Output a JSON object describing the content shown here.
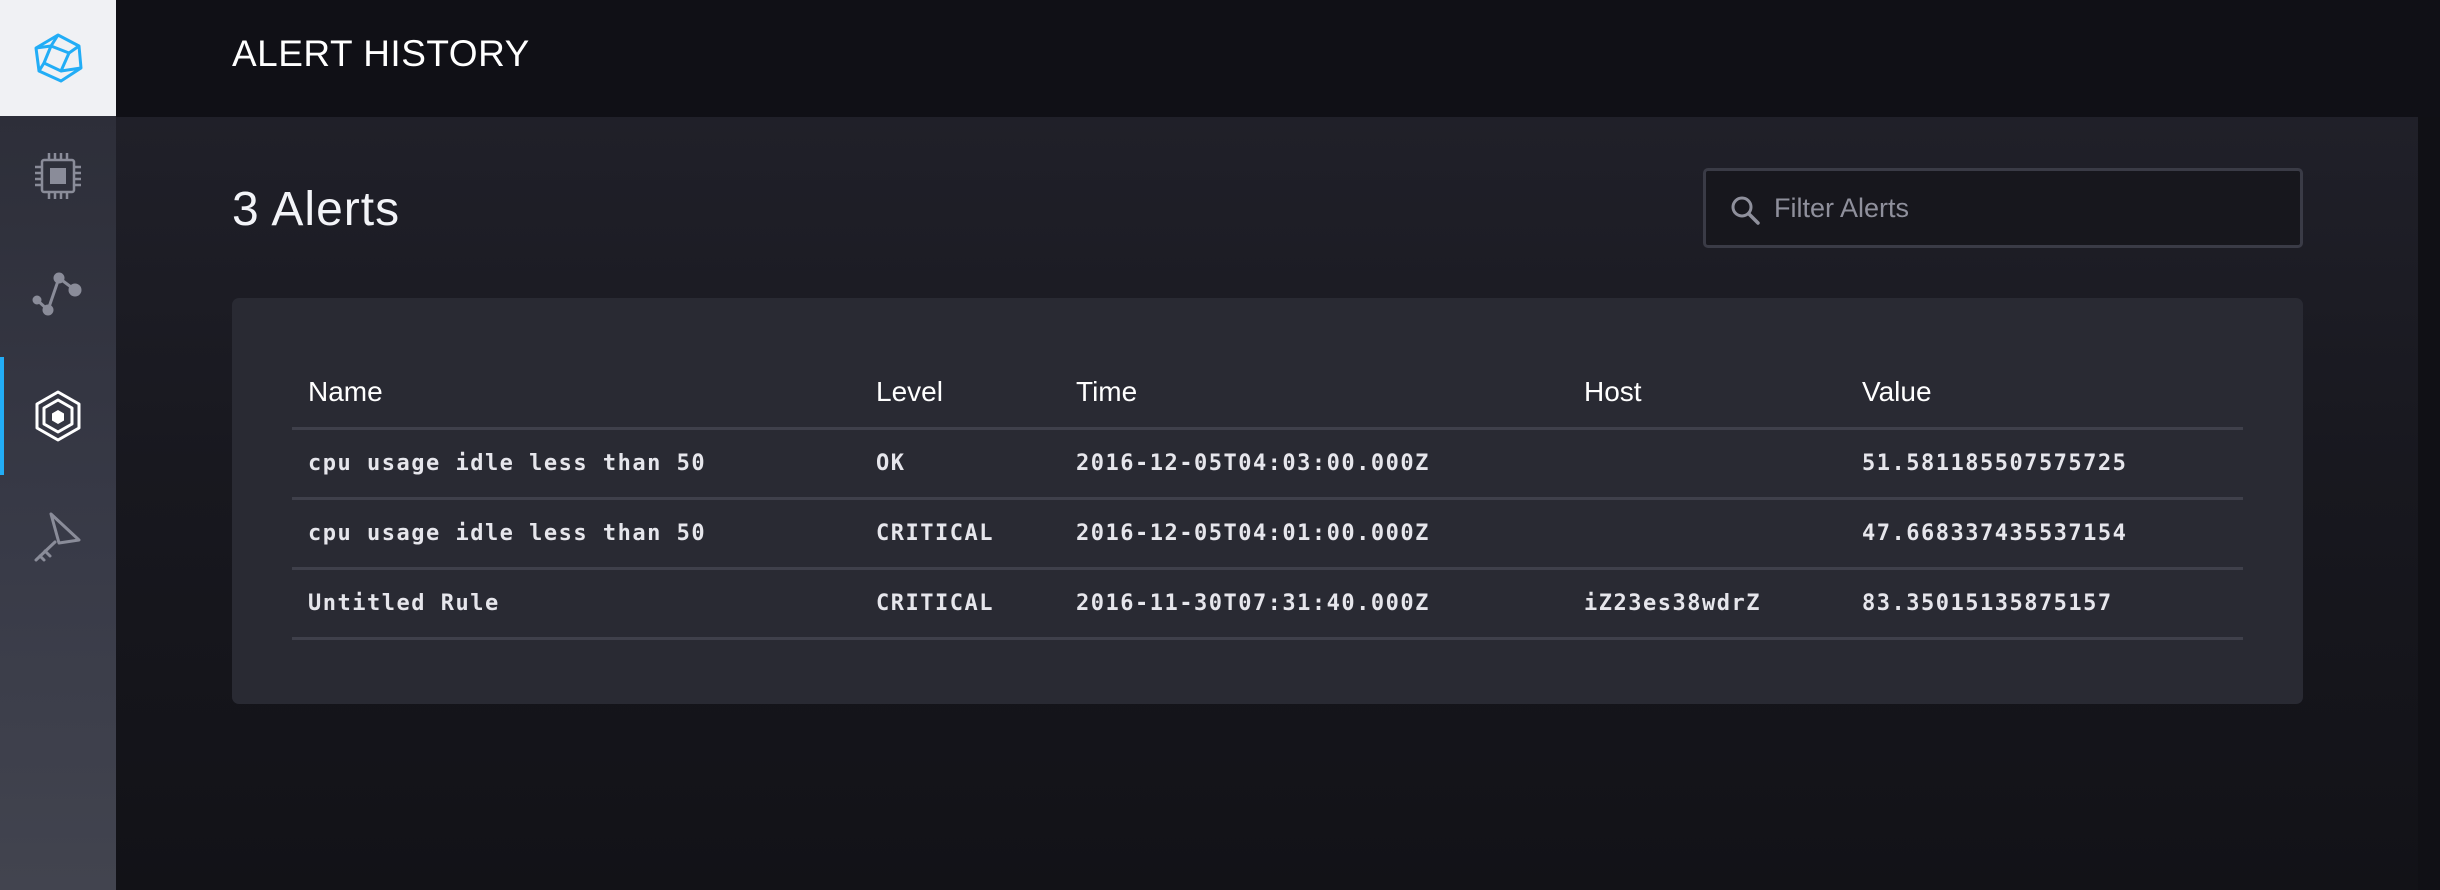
{
  "colors": {
    "accent": "#22adf6",
    "sidebar_logo_bg": "#f0f1f4",
    "header_bg": "#101016",
    "panel_bg": "#292a33"
  },
  "sidebar": {
    "logo_icon": "chronograf-logo-icon",
    "items": [
      {
        "name": "host-list",
        "icon": "cpu-chip-icon",
        "active": false
      },
      {
        "name": "data-explorer",
        "icon": "graph-nodes-icon",
        "active": false
      },
      {
        "name": "alerting",
        "icon": "alert-hexagon-icon",
        "active": true
      },
      {
        "name": "configuration",
        "icon": "config-icon",
        "active": false
      }
    ]
  },
  "header": {
    "title": "ALERT HISTORY"
  },
  "main": {
    "alert_count": "3 Alerts",
    "filter": {
      "placeholder": "Filter Alerts",
      "value": ""
    },
    "table": {
      "columns": {
        "name": "Name",
        "level": "Level",
        "time": "Time",
        "host": "Host",
        "value": "Value"
      },
      "rows": [
        {
          "name": "cpu usage idle less than 50",
          "level": "OK",
          "time": "2016-12-05T04:03:00.000Z",
          "host": "",
          "value": "51.581185507575725"
        },
        {
          "name": "cpu usage idle less than 50",
          "level": "CRITICAL",
          "time": "2016-12-05T04:01:00.000Z",
          "host": "",
          "value": "47.668337435537154"
        },
        {
          "name": "Untitled Rule",
          "level": "CRITICAL",
          "time": "2016-11-30T07:31:40.000Z",
          "host": "iZ23es38wdrZ",
          "value": "83.35015135875157"
        }
      ]
    }
  }
}
